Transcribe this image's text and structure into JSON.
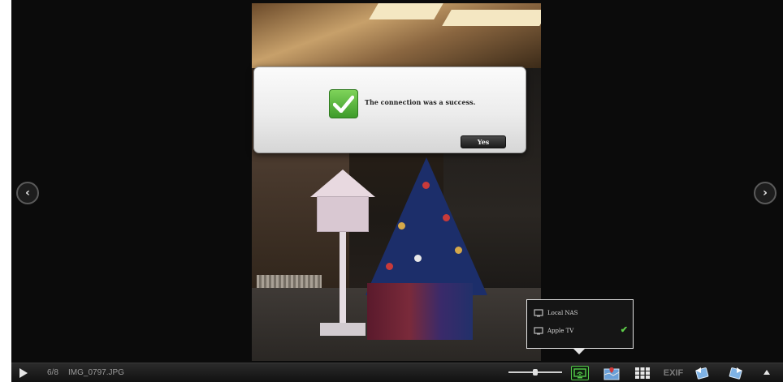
{
  "dialog": {
    "message": "The connection was a success.",
    "yes_label": "Yes"
  },
  "device_popup": {
    "items": [
      {
        "label": "Local NAS",
        "selected": false
      },
      {
        "label": "Apple TV",
        "selected": true
      }
    ],
    "selected_mark": "✔"
  },
  "navigation": {
    "prev_glyph": "‹",
    "next_glyph": "›"
  },
  "toolbar": {
    "counter": "6/8",
    "filename": "IMG_0797.JPG",
    "exif_label": "EXIF",
    "zoom_fraction": 0.5
  },
  "icons": {
    "play": "play-icon",
    "stream": "stream-to-device-icon",
    "map": "map-icon",
    "grid": "thumbnail-grid-icon",
    "rotate_left": "rotate-left-icon",
    "rotate_right": "rotate-right-icon",
    "up": "chevron-up-icon",
    "check": "checkmark-icon",
    "monitor": "monitor-icon"
  },
  "colors": {
    "accent_green": "#54c94a",
    "background": "#0b0b0b"
  }
}
